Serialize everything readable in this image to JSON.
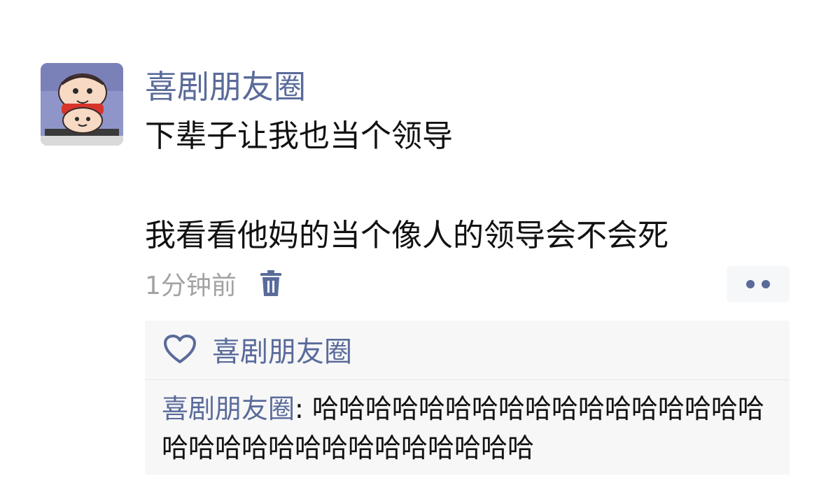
{
  "post": {
    "author": "喜剧朋友圈",
    "content_line1": "下辈子让我也当个领导",
    "content_line2": "我看看他妈的当个像人的领导会不会死",
    "time": "1分钟前",
    "avatar_icon": "cartoon-avatar-icon",
    "delete_icon": "trash-icon",
    "more_icon": "more-dots-icon"
  },
  "likes": {
    "icon": "heart-icon",
    "names": "喜剧朋友圈"
  },
  "comment": {
    "author": "喜剧朋友圈",
    "separator": ": ",
    "text": "哈哈哈哈哈哈哈哈哈哈哈哈哈哈哈哈哈哈哈哈哈哈哈哈哈哈哈哈哈哈哈"
  },
  "colors": {
    "link_blue": "#5a6b9a",
    "time_gray": "#a3a3a3",
    "panel_bg": "#f7f7f8"
  }
}
